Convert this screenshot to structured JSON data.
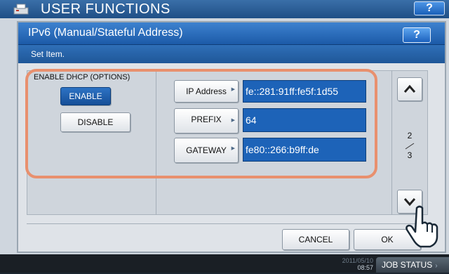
{
  "background": {
    "title": "USER FUNCTIONS",
    "help_label": "?",
    "clock_date": "2011/05/10",
    "clock_time": "08:57",
    "job_status": "JOB STATUS"
  },
  "dialog": {
    "title": "IPv6 (Manual/Stateful Address)",
    "help_label": "?",
    "subtitle": "Set Item.",
    "dhcp": {
      "label": "ENABLE DHCP (OPTIONS)",
      "enable_label": "ENABLE",
      "disable_label": "DISABLE",
      "selected": "ENABLE"
    },
    "fields": [
      {
        "label": "IP Address",
        "value": "fe::281:91ff:fe5f:1d55"
      },
      {
        "label": "PREFIX",
        "value": "64"
      },
      {
        "label": "GATEWAY",
        "value": "fe80::266:b9ff:de"
      }
    ],
    "page": {
      "current": "2",
      "total": "3"
    },
    "cancel_label": "CANCEL",
    "ok_label": "OK"
  },
  "colors": {
    "accent": "#1d63b8",
    "highlight": "#e8906e",
    "title_bar": "#2f6fb8"
  }
}
